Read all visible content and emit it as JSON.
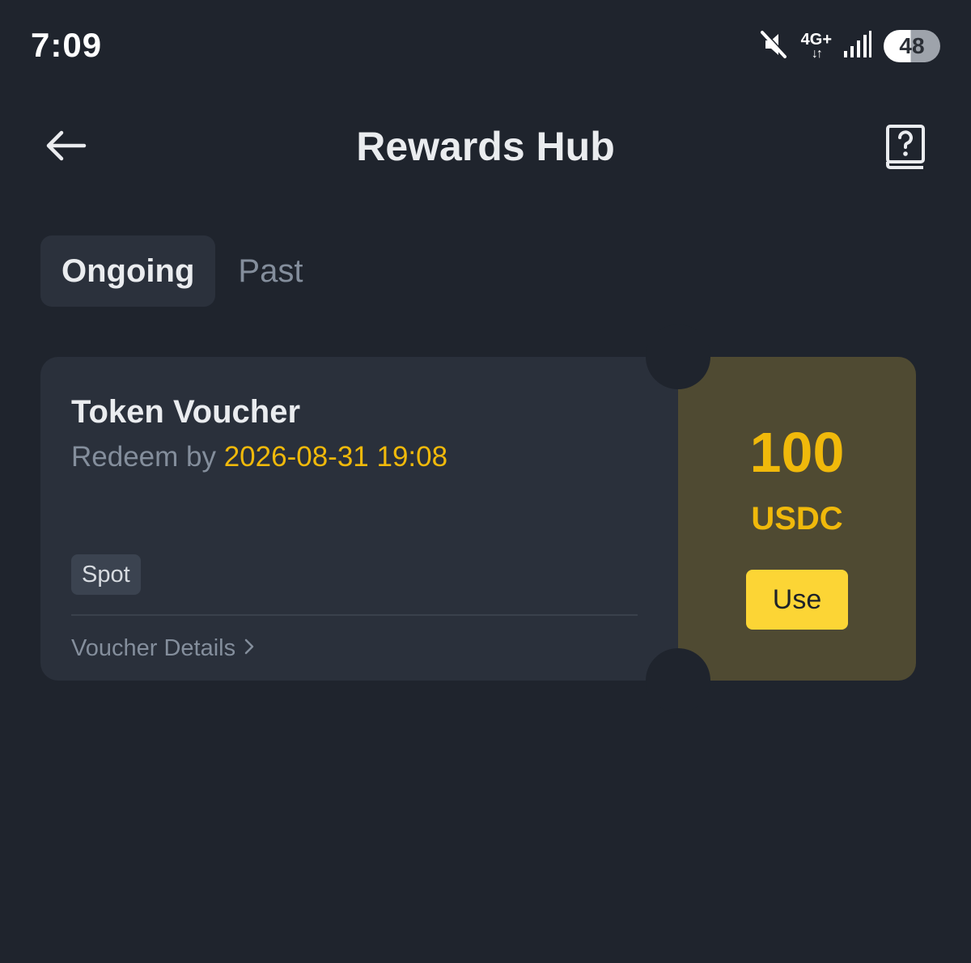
{
  "status_bar": {
    "time": "7:09",
    "network_type": "4G+",
    "network_arrows": "↓↑",
    "battery_level": "48",
    "icons": [
      "muted-icon",
      "signal-icon",
      "battery-icon"
    ]
  },
  "header": {
    "title": "Rewards Hub",
    "back_icon": "arrow-left-icon",
    "help_icon": "help-book-icon"
  },
  "tabs": [
    {
      "label": "Ongoing",
      "active": true
    },
    {
      "label": "Past",
      "active": false
    }
  ],
  "voucher": {
    "title": "Token Voucher",
    "redeem_label": "Redeem by",
    "redeem_date": "2026-08-31 19:08",
    "tag": "Spot",
    "details_link": "Voucher Details",
    "amount": "100",
    "currency": "USDC",
    "use_button": "Use"
  },
  "colors": {
    "background": "#1f242d",
    "card": "#2a303b",
    "card_accent": "#4f4a32",
    "accent_yellow": "#f0b90b",
    "button_yellow": "#fcd535",
    "muted_text": "#848e9c"
  }
}
